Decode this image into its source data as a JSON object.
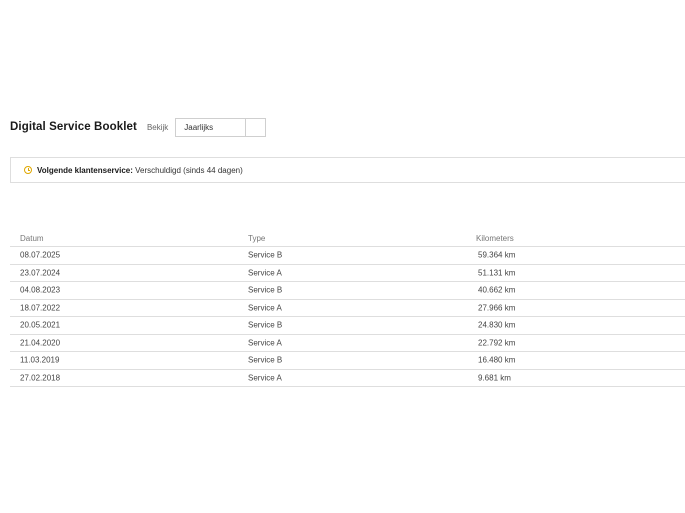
{
  "header": {
    "title": "Digital Service Booklet",
    "view_label": "Bekijk",
    "view_select_value": "Jaarlijks"
  },
  "banner": {
    "label": "Volgende klantenservice:",
    "status": "Verschuldigd (sinds 44 dagen)",
    "icon": "clock-icon",
    "icon_color": "#e0a800"
  },
  "table": {
    "columns": [
      "Datum",
      "Type",
      "Kilometers"
    ],
    "rows": [
      {
        "date": "08.07.2025",
        "type": "Service B",
        "km": "59.364 km"
      },
      {
        "date": "23.07.2024",
        "type": "Service A",
        "km": "51.131 km"
      },
      {
        "date": "04.08.2023",
        "type": "Service B",
        "km": "40.662 km"
      },
      {
        "date": "18.07.2022",
        "type": "Service A",
        "km": "27.966 km"
      },
      {
        "date": "20.05.2021",
        "type": "Service B",
        "km": "24.830 km"
      },
      {
        "date": "21.04.2020",
        "type": "Service A",
        "km": "22.792 km"
      },
      {
        "date": "11.03.2019",
        "type": "Service B",
        "km": "16.480 km"
      },
      {
        "date": "27.02.2018",
        "type": "Service A",
        "km": "9.681 km"
      }
    ]
  }
}
